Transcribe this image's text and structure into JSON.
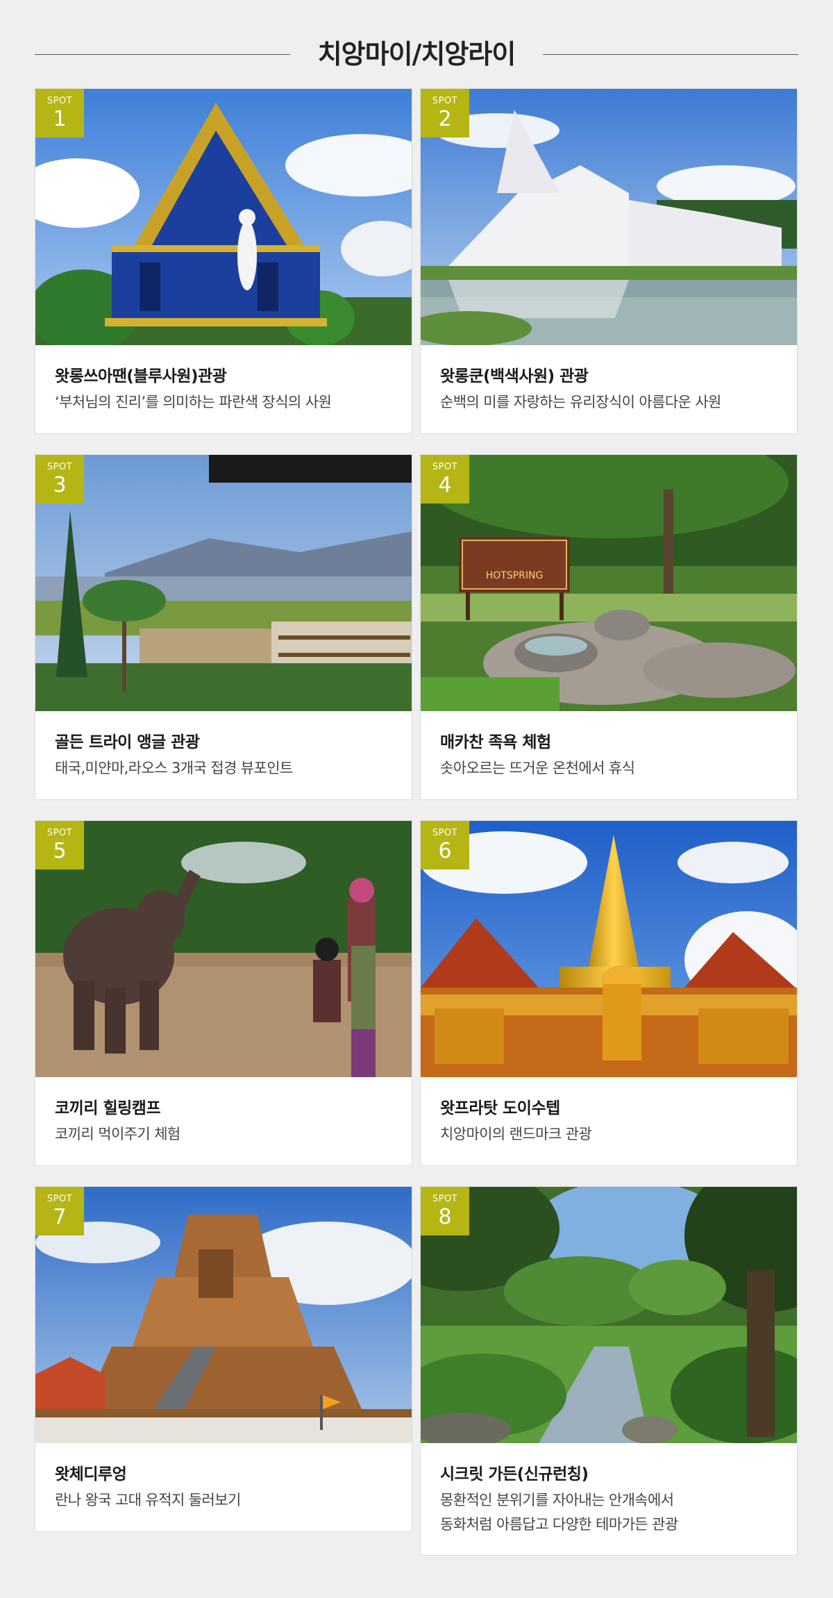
{
  "page": {
    "title": "치앙마이/치앙라이",
    "background": "#efefef",
    "badge_color": "#b5b514"
  },
  "spots": [
    {
      "badge_label": "SPOT",
      "number": "1",
      "title": "왓롱쓰아땐(블루사원)관광",
      "desc": "‘부처님의 진리’를 의미하는 파란색 장식의 사원"
    },
    {
      "badge_label": "SPOT",
      "number": "2",
      "title": "왓롱쿤(백색사원) 관광",
      "desc": "순백의 미를 자랑하는 유리장식이 아름다운 사원"
    },
    {
      "badge_label": "SPOT",
      "number": "3",
      "title": "골든 트라이 앵글 관광",
      "desc": "태국,미얀마,라오스 3개국 접경 뷰포인트"
    },
    {
      "badge_label": "SPOT",
      "number": "4",
      "title": "매카찬 족욕 체험",
      "desc": "솟아오르는 뜨거운 온천에서 휴식",
      "sign_text": "HOTSPRING"
    },
    {
      "badge_label": "SPOT",
      "number": "5",
      "title": "코끼리 힐링캠프",
      "desc": "코끼리 먹이주기 체험"
    },
    {
      "badge_label": "SPOT",
      "number": "6",
      "title": "왓프라탓 도이수텝",
      "desc": "치앙마이의 랜드마크 관광"
    },
    {
      "badge_label": "SPOT",
      "number": "7",
      "title": "왓체디루엉",
      "desc": "란나 왕국 고대 유적지 둘러보기"
    },
    {
      "badge_label": "SPOT",
      "number": "8",
      "title": "시크릿 가든(신규런칭)",
      "desc_line1": "몽환적인 분위기를 자아내는 안개속에서",
      "desc_line2": "동화처럼 아름답고 다양한 테마가든 관광"
    }
  ]
}
